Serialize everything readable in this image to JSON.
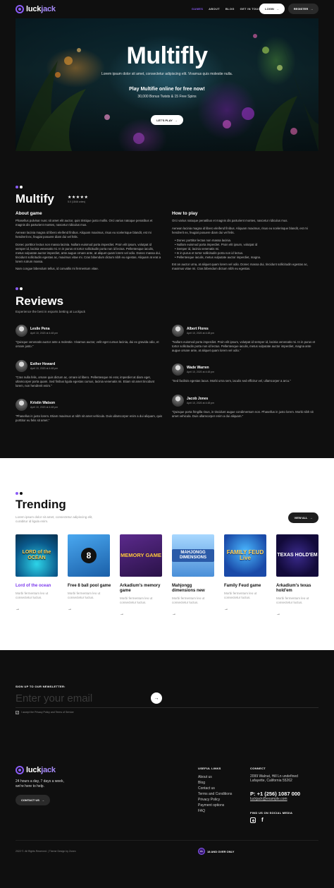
{
  "brand": {
    "name_prefix": "luck",
    "name_suffix": "jack"
  },
  "nav": {
    "items": [
      "GAMES",
      "ABOUT",
      "BLOG",
      "GET IN TOUCH"
    ],
    "active": "GAMES"
  },
  "header": {
    "login_label": "LOGIN",
    "register_label": "REGISTER"
  },
  "hero": {
    "title": "Multifly",
    "subtitle": "Lorem ipsum dolor sit amet, consectetur adipiscing elit. Vivamus quis molestie nulla.",
    "cta_heading": "Play Multifie online for free now!",
    "spins_text": "30,000 Bonus Twists & 15 Free Spins",
    "play_label": "LET'S PLAY"
  },
  "game": {
    "title": "Multify",
    "stars": "★★★★★",
    "rating": 5,
    "votes": "5.0 (1846 votes)",
    "about_heading": "About game",
    "about_paragraphs": [
      "Phasellus pulvinar nunc sit amet elit auctor, quis tristique justo mollis. Orci varius natoque penatibus et magnis dis parturient montes, nascetur ridiculus mus.",
      "Aenean lacinia magna id libero eleifend finibus. Aliquam maximus, risus eu scelerisque blandit, est mi hendrerit ex, feugiat posuere diam dui vel felis.",
      "Donec porttitor lectus non massa lacinia. Nullam euismod porta imperdiet. Proin elit ipsum, volutpat id semper id, lacinia venenatis mi. In in purus et tortor sollicitudin porta non id lectus. Pellentesque iaculis, metus vulputate auctor imperdiet, ante augue ornare ante, at aliquet quam lorem vel odio. Donec massa dui, tincidunt sollicitudin egestas ac, maximus vitae mi. Cras bibendum dictum nibh eu egestas. Aliquam at erat a lorem rutrum massa.",
      "Nam congue bibendum tellus, id convallis mi fermentum vitae."
    ],
    "howto_heading": "How to play",
    "howto_paragraphs": [
      "Orci varius natoque penatibus et magnis dis parturient montes, nascetur ridiculus mus.",
      "Aenean lacinia magna id libero eleifend finibus. Aliquam maximus, risus eu scelerisque blandit, est mi hendrerit ex, feugiat posuere diam dui vel felis."
    ],
    "howto_bullets": [
      "Donec porttitor lectus non massa lacinia.",
      "Nullam euismod porta imperdiet. Proin elit ipsum, volutpat id",
      "Semper id, lacinia venenatis mi.",
      "In in purus et tortor sollicitudin porta non id lectus.",
      "Pellentesque iaculis, metus vulputate auctor imperdiet, magna."
    ],
    "howto_footer": "Est an auctor urna, at aliquet quam lorem vel odio. Donec massa dui, tincidunt sollicitudin egestas ac, maximus vitae mi. Cras bibendum dictum nibh eu egestas."
  },
  "reviews": {
    "title": "Reviews",
    "subtitle": "Experience the best in esports betting at Luckjack",
    "items": [
      {
        "name": "Leslie Pena",
        "date": "April 10, 2020 at 4:48 pm",
        "text": "\"Quisque venenatis auctor ante a molestie. Vivamus auctor, velit eget cursus lacinia, dui ex gravida odio, et ornare justo.\""
      },
      {
        "name": "Albert Flores",
        "date": "April 10, 2020 at 4:48 pm",
        "text": "\"Nullam euismod porta imperdiet. Proin elit ipsum, volutpat id semper id, lacinia venenatis mi. In in purus et tortor sollicitudin porta non id lectus. Pellentesque iaculis, metus vulputate auctor imperdiet, magna ante augue ornare ante, at aliquet quam lorem vel odio.\""
      },
      {
        "name": "Esther Howard",
        "date": "April 10, 2020 at 4:48 pm",
        "text": "\"Cras nulla felis, ornare quis dictum ac, ornare id libero. Pellentesque mi erat, imperdiet at diam eget, ullamcorper porta quam. Sed finibus ligula egestas cursus, lacinia venenatis mi. Etiam sit amet tincidunt lorem, non hendrerit enim.\""
      },
      {
        "name": "Wade Warren",
        "date": "April 10, 2020 at 4:48 pm",
        "text": "\"Sed facilisis egestas lacus. Morbi urna sem, iaculis sed efficitur vel, ullamcorper a arcu.\""
      },
      {
        "name": "Kristin Watson",
        "date": "April 10, 2020 at 4:48 pm",
        "text": "\"Phasellus in justo lorem. Etiam maximus ut nibh sit amet vehicula. Duis ullamcorper enim a dui aliquam, quis porttitor eu felis sit amet.\""
      },
      {
        "name": "Jacob Jones",
        "date": "April 10, 2020 at 4:48 pm",
        "text": "\"Quisque porta fringilla risus, in tincidunt augue condimentum non. Phasellus in justo lorem. Morbi nibh sit amet vehicula. Duis ullamcorper enim a dui aliquam.\""
      }
    ]
  },
  "trending": {
    "title": "Trending",
    "subtitle": "Lorem ipsum dolor sit amet, consectetur adipiscing elit, curabitur id ligula enim.",
    "view_all_label": "VIEW ALL",
    "games": [
      {
        "name": "Lord of the ocean",
        "desc": "Morbi fermentum leo ut consectetur luctus.",
        "thumb_text": "LORD of the OCEAN",
        "highlight": true
      },
      {
        "name": "Free 8 ball pool game",
        "desc": "Morbi fermentum leo ut consectetur luctus.",
        "thumb_text": "8"
      },
      {
        "name": "Arkadium's memory game",
        "desc": "Morbi fermentum leo ut consectetur luctus.",
        "thumb_text": "MEMORY GAME"
      },
      {
        "name": "Mahjongg dimensions new",
        "desc": "Morbi fermentum leo ut consectetur luctus.",
        "thumb_text": "MAHJONGG DIMENSIONS"
      },
      {
        "name": "Family Feud game",
        "desc": "Morbi fermentum leo ut consectetur luctus.",
        "thumb_text": "FAMILY FEUD Live"
      },
      {
        "name": "Arkadium's texas hold'em",
        "desc": "Morbi fermentum leo ut consectetur luctus.",
        "thumb_text": "TEXAS HOLD'EM"
      }
    ]
  },
  "newsletter": {
    "label": "SIGN UP TO OUR NEWSLETTER:",
    "placeholder": "Enter your email",
    "terms": "I accept the Privacy Policy and Terms of Service"
  },
  "footer": {
    "tagline": "24 hours a day, 7 days a week, we're here to help.",
    "contact_label": "CONTACT US",
    "useful_heading": "USEFUL LINKS",
    "useful_links": [
      "About us",
      "Blog",
      "Contact us",
      "Terms and Conditions",
      "Privacy Policy",
      "Payment options",
      "FAQ"
    ],
    "contact_heading": "CONNECT",
    "address": "2099 Walnut, Hill Ln undefined Lafayette, California 55262",
    "phone": "P: +1 (256) 1087 000",
    "email": "luckjack@example.com",
    "social_heading": "FIND US ON SOCIAL MEDIA",
    "copyright": "2022 ©. All Rights Reserved. | Theme Design by Zonex",
    "age_badge": "18+",
    "age_text": "18 AND OVER ONLY"
  },
  "colors": {
    "accent": "#8b5cf6",
    "background": "#0f0f0f",
    "light_section": "#ffffff"
  }
}
